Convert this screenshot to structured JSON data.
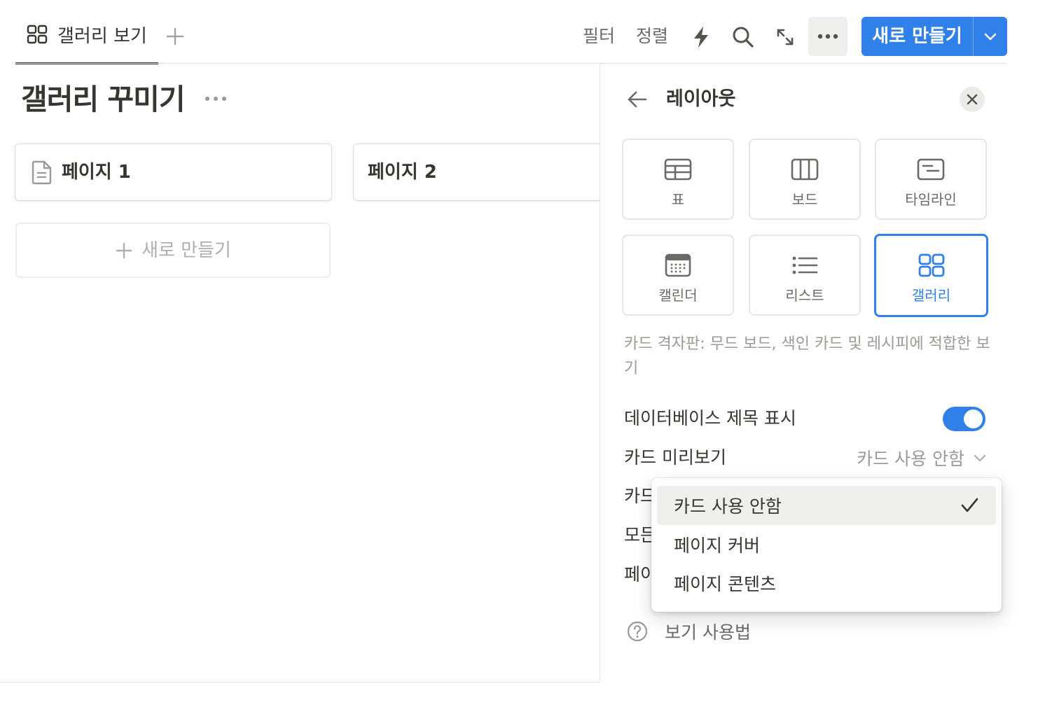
{
  "topbar": {
    "view_tab_label": "갤러리 보기",
    "filter_label": "필터",
    "sort_label": "정렬",
    "new_button_label": "새로 만들기"
  },
  "main": {
    "database_title": "갤러리 꾸미기",
    "cards": [
      {
        "title": "페이지 1"
      },
      {
        "title": "페이지 2"
      }
    ],
    "add_card_label": "새로 만들기"
  },
  "panel": {
    "title": "레이아웃",
    "layouts": [
      {
        "label": "표",
        "icon": "table-icon"
      },
      {
        "label": "보드",
        "icon": "board-icon"
      },
      {
        "label": "타임라인",
        "icon": "timeline-icon"
      },
      {
        "label": "캘린더",
        "icon": "calendar-icon"
      },
      {
        "label": "리스트",
        "icon": "list-icon"
      },
      {
        "label": "갤러리",
        "icon": "gallery-icon",
        "selected": true
      }
    ],
    "description": "카드 격자판: 무드 보드, 색인 카드 및 레시피에 적합한 보기",
    "settings": {
      "show_db_title_label": "데이터베이스 제목 표시",
      "show_db_title_on": true,
      "card_preview_label": "카드 미리보기",
      "card_preview_value": "카드 사용 안함",
      "card_size_label_partial": "카드",
      "all_label_partial": "모든",
      "page_label_partial": "페이"
    },
    "help_label": "보기 사용법"
  },
  "dropdown": {
    "items": [
      {
        "label": "카드 사용 안함",
        "checked": true
      },
      {
        "label": "페이지 커버",
        "checked": false
      },
      {
        "label": "페이지 콘텐츠",
        "checked": false
      }
    ]
  },
  "colors": {
    "accent": "#2f80e8",
    "text": "#37352f",
    "muted": "#9b9a97"
  }
}
